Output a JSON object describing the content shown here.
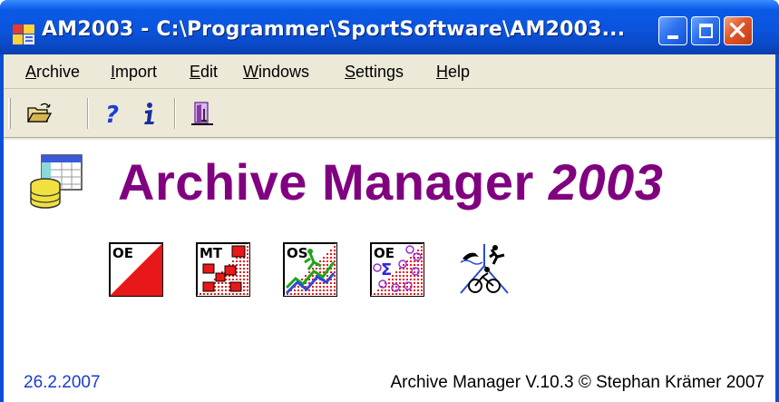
{
  "window": {
    "title": "AM2003  -  C:\\Programmer\\SportSoftware\\AM2003...",
    "icon": "am2003-app-icon",
    "title_color": "#0b54dc"
  },
  "menu": {
    "items": [
      {
        "label": "Archive"
      },
      {
        "label": "Import"
      },
      {
        "label": "Edit"
      },
      {
        "label": "Windows"
      },
      {
        "label": "Settings"
      },
      {
        "label": "Help"
      }
    ]
  },
  "toolbar": {
    "buttons": [
      {
        "icon": "open-folder-icon"
      },
      {
        "icon": "help-icon"
      },
      {
        "icon": "info-icon"
      },
      {
        "icon": "exit-door-icon"
      }
    ]
  },
  "main": {
    "headline": "Archive Manager",
    "headline_year": "2003",
    "headline_color": "#800080",
    "modules": [
      {
        "icon": "oe-module-icon",
        "label": "OE"
      },
      {
        "icon": "mt-module-icon",
        "label": "MT"
      },
      {
        "icon": "os-module-icon",
        "label": "OS"
      },
      {
        "icon": "oe-sigma-module-icon",
        "label": "OE"
      },
      {
        "icon": "triathlon-module-icon"
      }
    ]
  },
  "footer": {
    "date": "26.2.2007",
    "copyright": "Archive Manager V.10.3 © Stephan Krämer 2007",
    "date_color": "#1a3bd0"
  }
}
